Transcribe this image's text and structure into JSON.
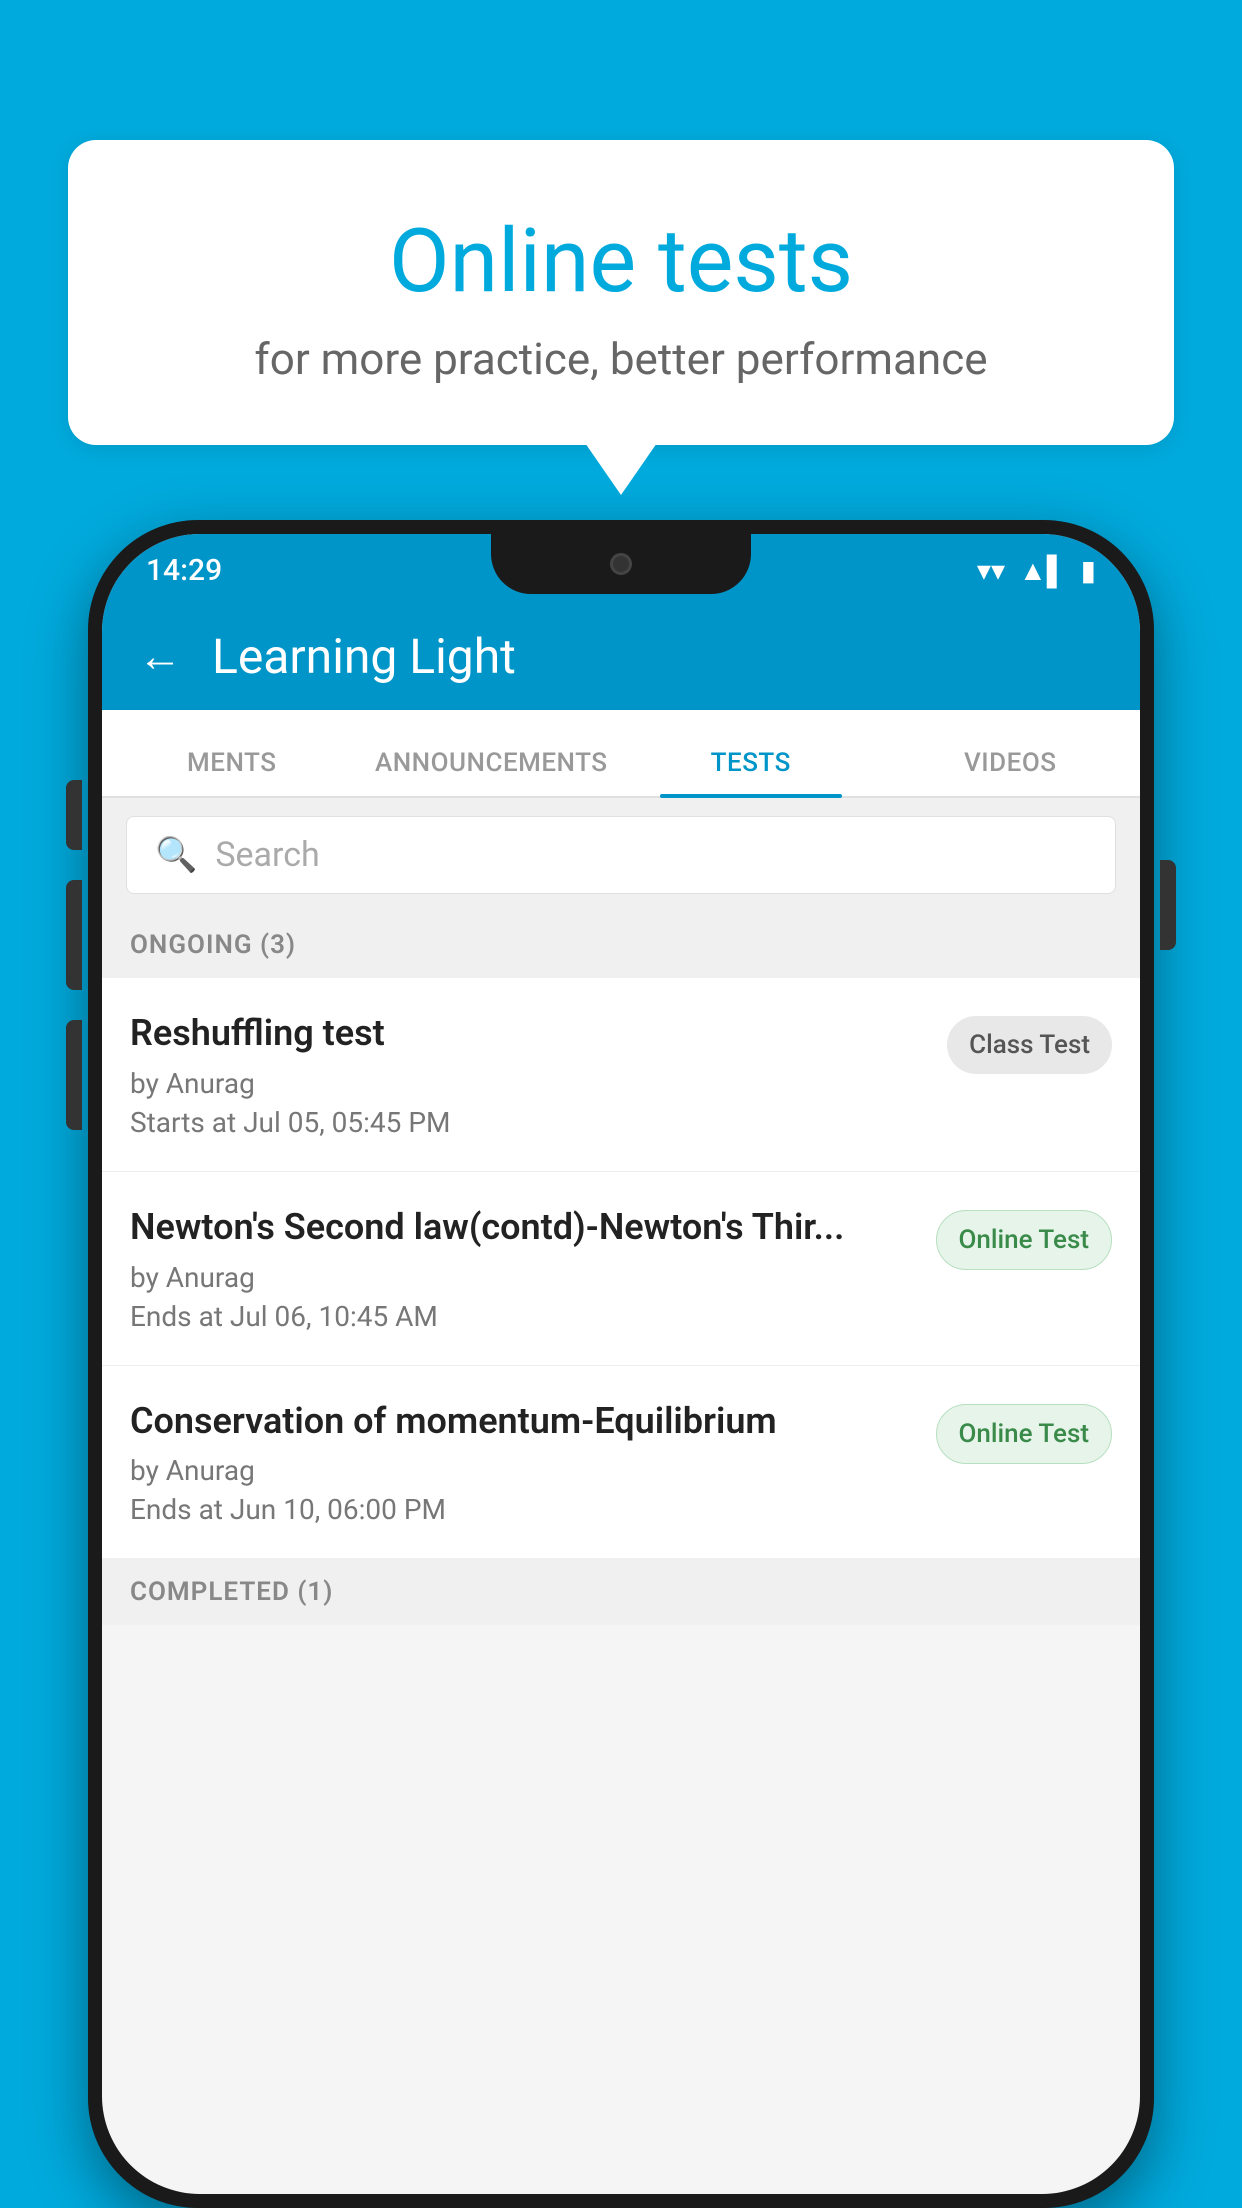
{
  "background": {
    "color": "#00AADD"
  },
  "speech_bubble": {
    "title": "Online tests",
    "subtitle": "for more practice, better performance"
  },
  "phone": {
    "status_bar": {
      "time": "14:29",
      "wifi": "▼",
      "signal": "▲",
      "battery": "▮"
    },
    "header": {
      "back_label": "←",
      "title": "Learning Light"
    },
    "tabs": [
      {
        "label": "MENTS",
        "active": false
      },
      {
        "label": "ANNOUNCEMENTS",
        "active": false
      },
      {
        "label": "TESTS",
        "active": true
      },
      {
        "label": "VIDEOS",
        "active": false
      }
    ],
    "search": {
      "placeholder": "Search"
    },
    "ongoing_section": {
      "label": "ONGOING (3)"
    },
    "tests": [
      {
        "name": "Reshuffling test",
        "author": "by Anurag",
        "time_label": "Starts at",
        "time": "Jul 05, 05:45 PM",
        "badge": "Class Test",
        "badge_type": "class"
      },
      {
        "name": "Newton's Second law(contd)-Newton's Thir...",
        "author": "by Anurag",
        "time_label": "Ends at",
        "time": "Jul 06, 10:45 AM",
        "badge": "Online Test",
        "badge_type": "online"
      },
      {
        "name": "Conservation of momentum-Equilibrium",
        "author": "by Anurag",
        "time_label": "Ends at",
        "time": "Jun 10, 06:00 PM",
        "badge": "Online Test",
        "badge_type": "online"
      }
    ],
    "completed_section": {
      "label": "COMPLETED (1)"
    }
  }
}
